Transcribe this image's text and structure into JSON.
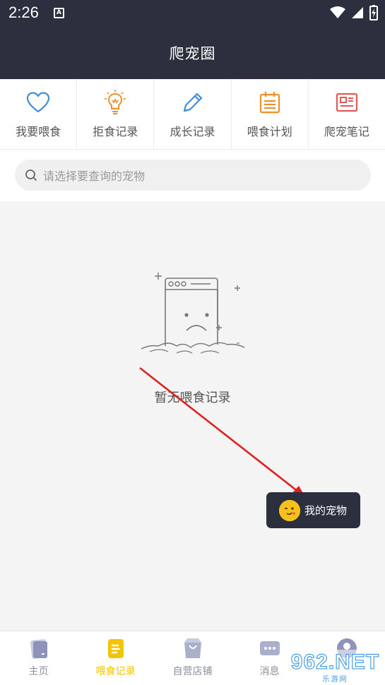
{
  "status": {
    "time": "2:26"
  },
  "header": {
    "title": "爬宠圈"
  },
  "quick_actions": [
    {
      "label": "我要喂食",
      "icon": "heart-icon",
      "color": "#3e8ed8"
    },
    {
      "label": "拒食记录",
      "icon": "lightbulb-icon",
      "color": "#f0902a"
    },
    {
      "label": "成长记录",
      "icon": "pencil-icon",
      "color": "#3e8ed8"
    },
    {
      "label": "喂食计划",
      "icon": "calendar-icon",
      "color": "#f0902a"
    },
    {
      "label": "爬宠笔记",
      "icon": "notes-icon",
      "color": "#e05a5a"
    }
  ],
  "search": {
    "placeholder": "请选择要查询的宠物"
  },
  "empty": {
    "text": "暂无喂食记录"
  },
  "floating": {
    "label": "我的宠物"
  },
  "tabs": [
    {
      "label": "主页",
      "active": false
    },
    {
      "label": "喂食记录",
      "active": true
    },
    {
      "label": "自营店铺",
      "active": false
    },
    {
      "label": "消息",
      "active": false
    },
    {
      "label": "",
      "active": false
    }
  ],
  "colors": {
    "header_bg": "#2c2f3e",
    "active_tab": "#f5c400",
    "inactive_tab": "#8b90a0",
    "arrow": "#e02020"
  },
  "watermark": {
    "main": "962.NET",
    "sub": "乐游网"
  }
}
